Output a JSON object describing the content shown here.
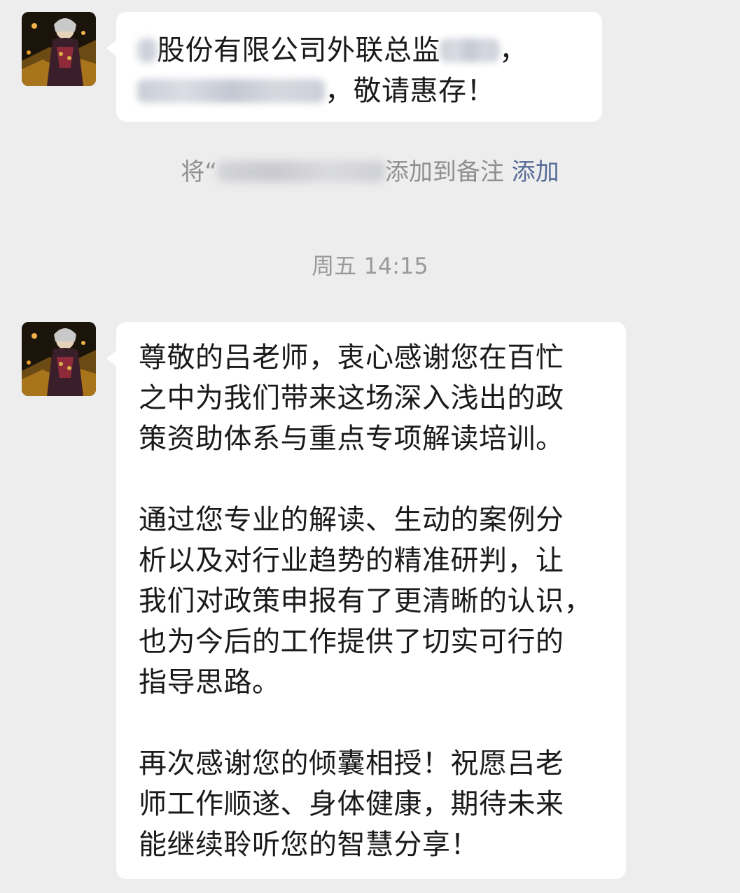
{
  "messages": [
    {
      "lines": [
        "股份有限公司外联总监",
        "，敬请惠存！"
      ]
    },
    {
      "paragraphs": [
        [
          "尊敬的吕老师，衷心感谢您在百忙",
          "之中为我们带来这场深入浅出的政",
          "策资助体系与重点专项解读培训。"
        ],
        [
          "通过您专业的解读、生动的案例分",
          "析以及对行业趋势的精准研判，让",
          "我们对政策申报有了更清晰的认识，",
          "也为今后的工作提供了切实可行的",
          "指导思路。"
        ],
        [
          "再次感谢您的倾囊相授！祝愿吕老",
          "师工作顺遂、身体健康，期待未来",
          "能继续聆听您的智慧分享！"
        ]
      ]
    }
  ],
  "system_note": {
    "prefix": "将“",
    "suffix": "添加到备注",
    "action": "添加"
  },
  "timestamp": "周五 14:15",
  "colors": {
    "background": "#ededed",
    "bubble": "#ffffff",
    "link": "#576b95",
    "system_text": "#8f8f8f"
  },
  "icons": [
    "avatar"
  ]
}
